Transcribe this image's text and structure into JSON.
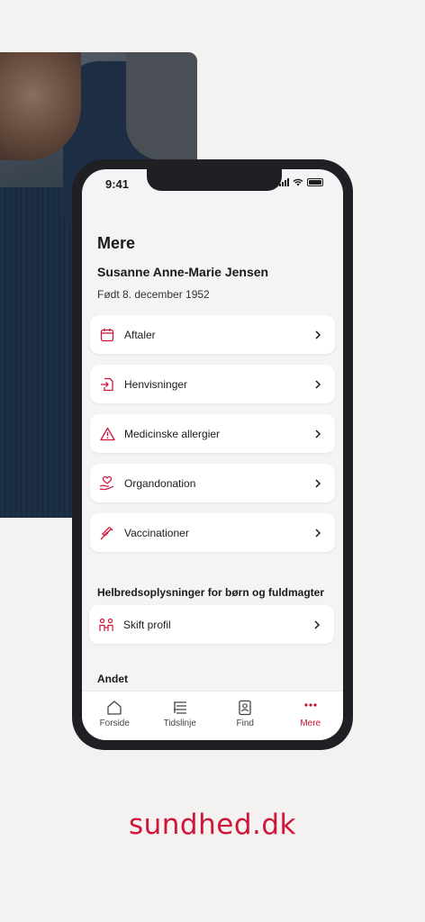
{
  "status_bar": {
    "time": "9:41"
  },
  "page": {
    "title": "Mere",
    "user_name": "Susanne Anne-Marie Jensen",
    "birth": "Født 8. december 1952"
  },
  "menu_items": [
    {
      "label": "Aftaler",
      "icon": "calendar-icon"
    },
    {
      "label": "Henvisninger",
      "icon": "referral-icon"
    },
    {
      "label": "Medicinske allergier",
      "icon": "warning-icon"
    },
    {
      "label": "Organdonation",
      "icon": "heart-hand-icon"
    },
    {
      "label": "Vaccinationer",
      "icon": "syringe-icon"
    }
  ],
  "section_family": {
    "heading": "Helbredsoplysninger for børn og fuldmagter",
    "item_label": "Skift profil"
  },
  "section_other": {
    "heading": "Andet"
  },
  "tabs": [
    {
      "label": "Forside",
      "icon": "home-icon"
    },
    {
      "label": "Tidslinje",
      "icon": "timeline-icon"
    },
    {
      "label": "Find",
      "icon": "contacts-icon"
    },
    {
      "label": "Mere",
      "icon": "more-icon",
      "active": true
    }
  ],
  "brand": {
    "logo_text": "sundhed.dk",
    "color": "#d0143a"
  }
}
